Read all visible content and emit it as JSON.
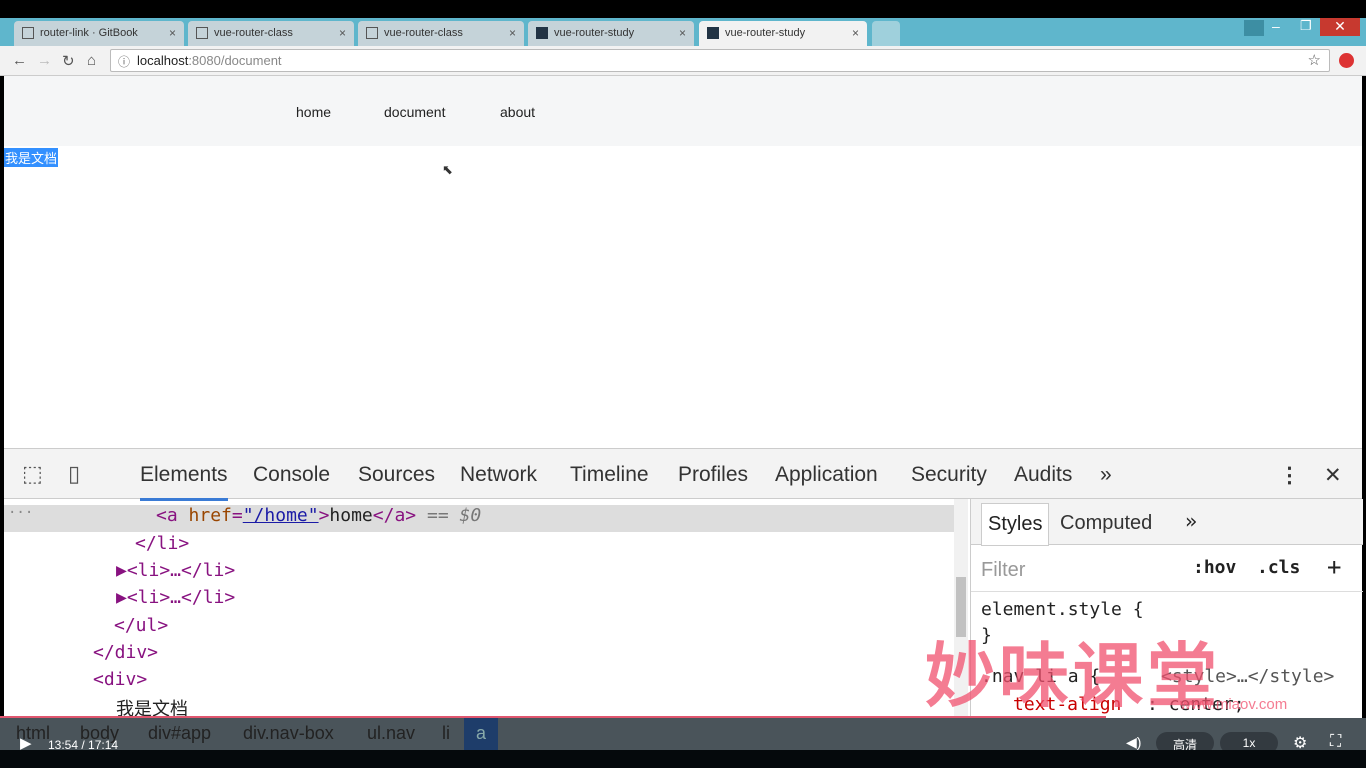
{
  "browser": {
    "tabs": [
      {
        "title": "router-link · GitBook",
        "icon": "book-icon"
      },
      {
        "title": "vue-router-class",
        "icon": "page-icon"
      },
      {
        "title": "vue-router-class",
        "icon": "page-icon"
      },
      {
        "title": "vue-router-study",
        "icon": "react-icon"
      },
      {
        "title": "vue-router-study",
        "icon": "react-icon",
        "active": true
      }
    ],
    "url_host": "localhost",
    "url_rest": ":8080/document"
  },
  "page": {
    "nav": [
      "home",
      "document",
      "about"
    ],
    "content": "我是文档"
  },
  "devtools": {
    "tabs": [
      "Elements",
      "Console",
      "Sources",
      "Network",
      "Timeline",
      "Profiles",
      "Application",
      "Security",
      "Audits"
    ],
    "more": "»",
    "elements": {
      "selected_tag_open": "<a ",
      "attr": "href",
      "val": "\"/home\"",
      "text": "home",
      "close": "</a>",
      "marker": "== $0",
      "lines": [
        "</li>",
        "▶<li>…</li>",
        "▶<li>…</li>",
        "</ul>",
        "</div>",
        "<div>",
        "我是文档"
      ]
    },
    "styles": {
      "tabs": [
        "Styles",
        "Computed"
      ],
      "filter_placeholder": "Filter",
      "hov": ":hov",
      "cls": ".cls",
      "plus": "+",
      "rules": [
        "element.style {",
        "}",
        ".nav li a {",
        "<style>…</style>",
        "text-align",
        "center;",
        "}"
      ]
    },
    "breadcrumbs": [
      "html",
      "body",
      "div#app",
      "div.nav-box",
      "ul.nav",
      "li",
      "a"
    ]
  },
  "video": {
    "time": "13:54 / 17:14",
    "quality": "高清",
    "speed": "1x",
    "progress_percent": 81
  },
  "watermark": {
    "text": "妙味课堂",
    "url": "www.miaov.com"
  }
}
